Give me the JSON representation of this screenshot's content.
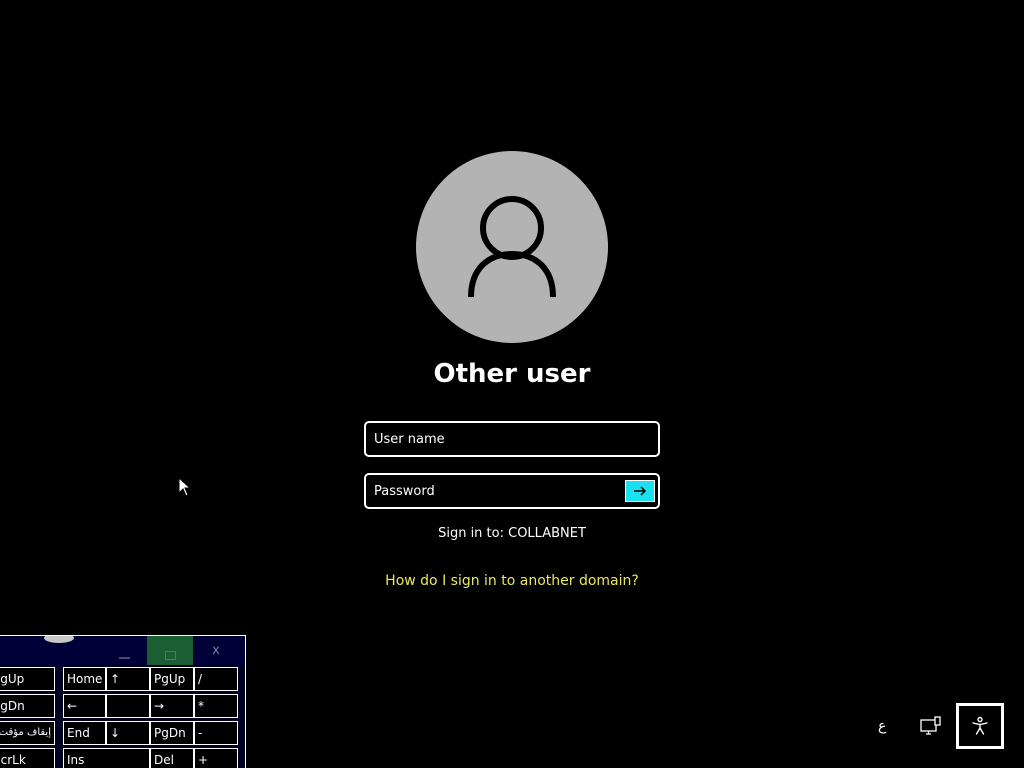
{
  "login": {
    "user_display_name": "Other user",
    "username_placeholder": "User name",
    "password_placeholder": "Password",
    "sign_in_to": "Sign in to: COLLABNET",
    "domain_link": "How do I sign in to another domain?"
  },
  "icons": {
    "avatar": "person-icon",
    "submit": "arrow-right-icon",
    "network": "network-monitor-icon",
    "accessibility": "accessibility-icon",
    "cursor": "mouse-pointer-icon"
  },
  "osk": {
    "close_label": "x",
    "keys": [
      [
        "PgUp",
        "Home",
        "↑",
        "PgUp",
        "/"
      ],
      [
        "PgDn",
        "←",
        "",
        "→",
        "*"
      ],
      [
        "إيقاف مؤقت",
        "End",
        "↓",
        "PgDn",
        "-"
      ],
      [
        "ScrLk",
        "Ins",
        "Del",
        "+"
      ]
    ]
  },
  "system": {
    "ime_indicator": "ع"
  },
  "colors": {
    "background": "#000000",
    "avatar": "#b3b3b3",
    "accent": "#1ae0f0",
    "link": "#e8e860"
  }
}
